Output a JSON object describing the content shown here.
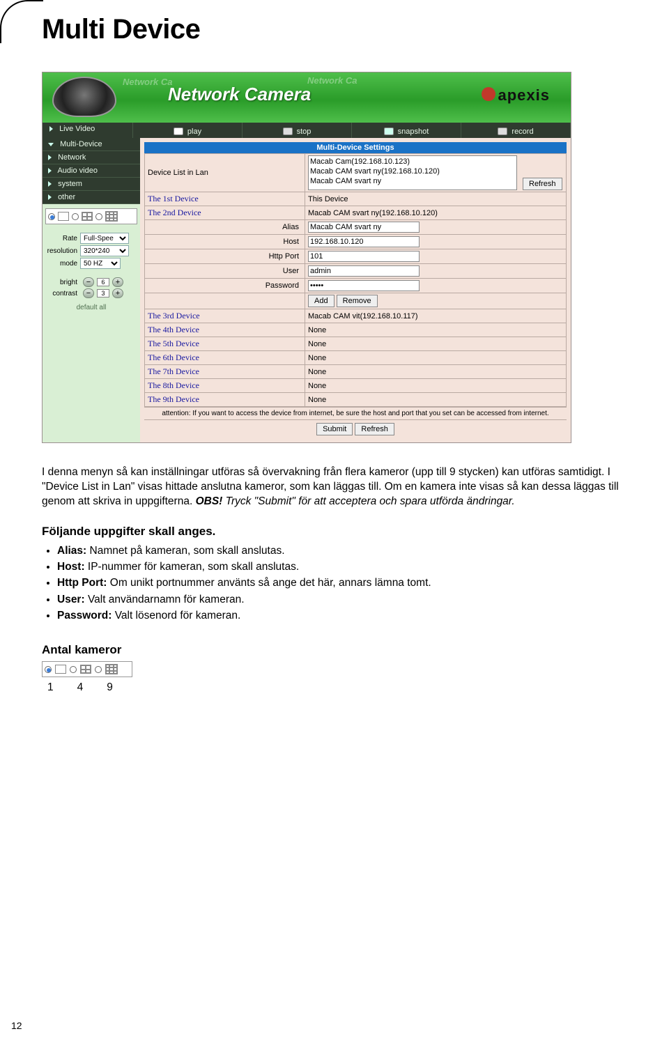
{
  "title": "Multi Device",
  "banner": {
    "product": "Network Camera",
    "ghost": "Network Ca",
    "brand": "apexis"
  },
  "toolbar": {
    "live": "Live Video",
    "play": "play",
    "stop": "stop",
    "snapshot": "snapshot",
    "record": "record"
  },
  "sidebar": {
    "items": [
      {
        "label": "Multi-Device",
        "open": true
      },
      {
        "label": "Network",
        "open": false
      },
      {
        "label": "Audio video",
        "open": false
      },
      {
        "label": "system",
        "open": false
      },
      {
        "label": "other",
        "open": false
      }
    ]
  },
  "controls": {
    "rate_label": "Rate",
    "rate_value": "Full-Spee",
    "resolution_label": "resolution",
    "resolution_value": "320*240",
    "mode_label": "mode",
    "mode_value": "50 HZ",
    "bright_label": "bright",
    "bright_value": "6",
    "contrast_label": "contrast",
    "contrast_value": "3",
    "default_all": "default all"
  },
  "mds": {
    "heading": "Multi-Device Settings",
    "list_label": "Device List in Lan",
    "list_items": [
      "Macab Cam(192.168.10.123)",
      "Macab CAM svart ny(192.168.10.120)",
      "Macab CAM svart ny"
    ],
    "refresh": "Refresh",
    "dev1_label": "The 1st Device",
    "dev1_val": "This Device",
    "dev2_label": "The 2nd Device",
    "dev2_val": "Macab CAM svart ny(192.168.10.120)",
    "alias_label": "Alias",
    "alias_val": "Macab CAM svart ny",
    "host_label": "Host",
    "host_val": "192.168.10.120",
    "port_label": "Http Port",
    "port_val": "101",
    "user_label": "User",
    "user_val": "admin",
    "pass_label": "Password",
    "pass_val": "•••••",
    "add": "Add",
    "remove": "Remove",
    "dev3_label": "The 3rd Device",
    "dev3_val": "Macab CAM vit(192.168.10.117)",
    "dev4_label": "The 4th Device",
    "dev4_val": "None",
    "dev5_label": "The 5th Device",
    "dev5_val": "None",
    "dev6_label": "The 6th Device",
    "dev6_val": "None",
    "dev7_label": "The 7th Device",
    "dev7_val": "None",
    "dev8_label": "The 8th Device",
    "dev8_val": "None",
    "dev9_label": "The 9th Device",
    "dev9_val": "None",
    "attention": "attention: If you want to access the device from internet, be sure the host and port that you set can be accessed from internet.",
    "submit": "Submit",
    "refresh2": "Refresh"
  },
  "body": {
    "p1_a": "I denna menyn så kan inställningar utföras så övervakning från flera kameror (upp till 9 stycken) kan utföras samtidigt. I \"Device List in Lan\" visas hittade anslutna kameror, som kan läggas till. Om en kamera inte visas så kan dessa läggas till genom att skriva in uppgifterna. ",
    "p1_obs": "OBS!",
    "p1_b": " Tryck \"Submit\" för att acceptera och spara utförda ändringar.",
    "sub": "Följande uppgifter skall anges.",
    "b_alias_k": "Alias:",
    "b_alias_v": " Namnet på kameran, som skall anslutas.",
    "b_host_k": "Host:",
    "b_host_v": " IP-nummer för kameran, som skall anslutas.",
    "b_port_k": "Http Port:",
    "b_port_v": " Om unikt portnummer använts så ange det här, annars lämna tomt.",
    "b_user_k": "User:",
    "b_user_v": " Valt användarnamn för kameran.",
    "b_pass_k": "Password:",
    "b_pass_v": " Valt lösenord för kameran.",
    "antal": "Antal kameror",
    "n1": "1",
    "n4": "4",
    "n9": "9"
  },
  "page_number": "12"
}
